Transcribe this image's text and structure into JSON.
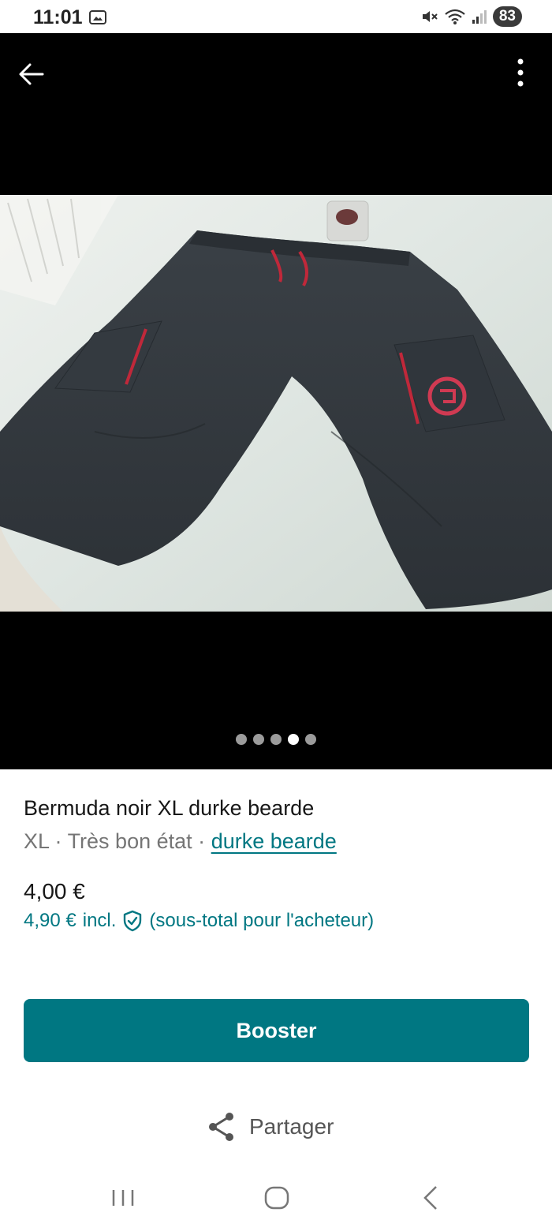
{
  "status": {
    "time": "11:01",
    "battery": "83",
    "icons": [
      "gallery-icon",
      "mute-icon",
      "wifi-icon",
      "signal-icon"
    ]
  },
  "viewer": {
    "back_icon": "arrow-left-icon",
    "more_icon": "more-vertical-icon",
    "dots_total": 5,
    "active_dot": 4
  },
  "listing": {
    "title": "Bermuda noir XL durke bearde",
    "size": "XL",
    "separator": "·",
    "condition": "Très bon état",
    "brand": "durke bearde",
    "price": "4,00 €",
    "price_incl": "4,90 €",
    "incl_label": "incl.",
    "incl_note": "(sous-total pour l'acheteur)"
  },
  "actions": {
    "booster_label": "Booster",
    "share_label": "Partager"
  },
  "colors": {
    "accent": "#007782",
    "viewer_bg": "#000000"
  }
}
